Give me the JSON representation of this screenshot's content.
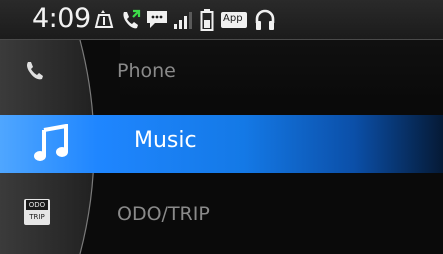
{
  "status_bar": {
    "time": "4:09",
    "app_badge": "App"
  },
  "menu": {
    "items": [
      {
        "label": "Phone",
        "icon": "phone-icon",
        "selected": false
      },
      {
        "label": "Music",
        "icon": "music-note-icon",
        "selected": true
      },
      {
        "label": "ODO/TRIP",
        "icon": "odo-trip-icon",
        "selected": false
      }
    ],
    "odo_icon_text": {
      "top": "ODO",
      "bottom": "TRIP"
    }
  },
  "colors": {
    "selection": "#1479e6",
    "text_dim": "#8a8a8a",
    "text_bright": "#ffffff"
  }
}
